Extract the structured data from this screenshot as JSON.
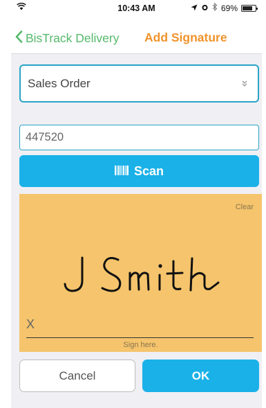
{
  "status_bar": {
    "time": "10:43 AM",
    "battery_percent": "69%",
    "battery_level": 0.69,
    "icons": [
      "wifi-icon",
      "location-icon",
      "alarm-icon",
      "bluetooth-icon",
      "battery-icon"
    ]
  },
  "nav": {
    "back_label": "BisTrack Delivery",
    "title": "Add Signature"
  },
  "form": {
    "document_type": {
      "selected": "Sales Order"
    },
    "order_number": {
      "value": "447520"
    },
    "scan_label": "Scan"
  },
  "signature": {
    "clear_label": "Clear",
    "signed_text": "J Smith",
    "x_marker": "X",
    "hint": "Sign here."
  },
  "actions": {
    "cancel_label": "Cancel",
    "ok_label": "OK"
  },
  "colors": {
    "accent_green": "#55b96b",
    "title_orange": "#f0932b",
    "primary_blue": "#1ab1e8",
    "pad_yellow": "#f5c46c"
  }
}
